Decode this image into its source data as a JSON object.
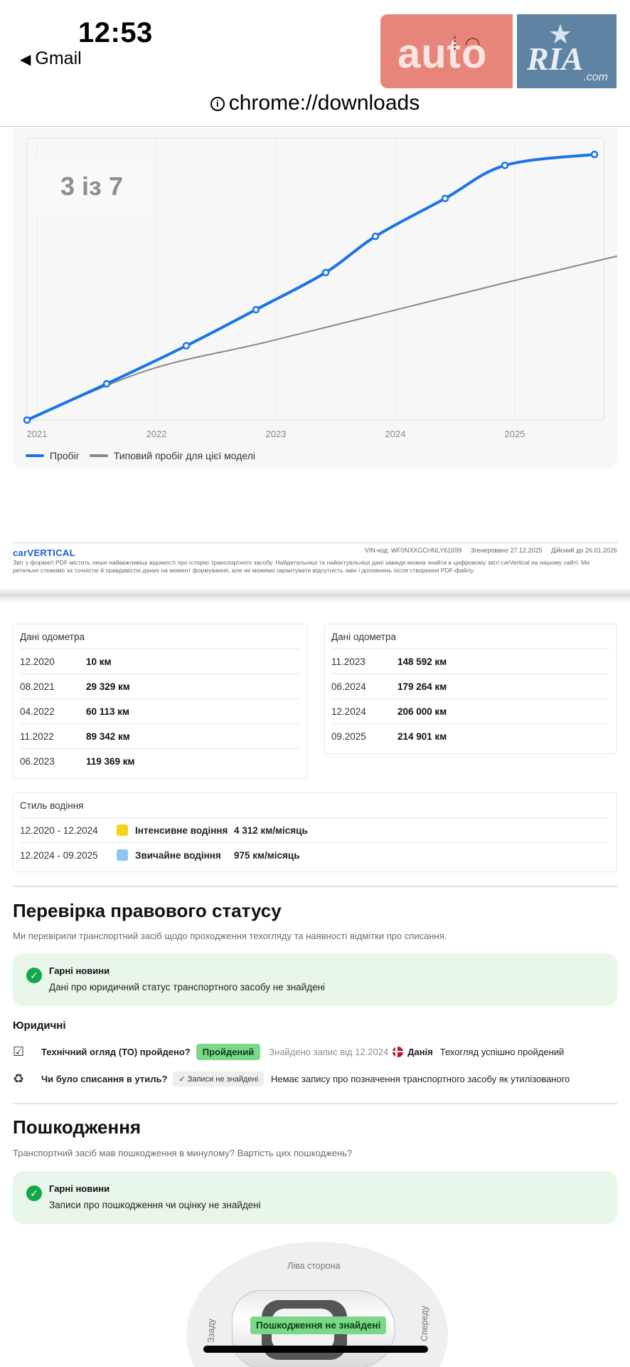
{
  "status": {
    "time": "12:53",
    "back_app": "Gmail",
    "url": "chrome://downloads"
  },
  "watermark": {
    "part1": "auto",
    "part2": "RIA",
    "part3": ".com"
  },
  "viewer": {
    "page_indicator": "3 із 7"
  },
  "chart_data": {
    "type": "line",
    "x_ticks": [
      "2021",
      "2022",
      "2023",
      "2024",
      "2025"
    ],
    "series": [
      {
        "name": "Пробіг",
        "color": "#1a73e8",
        "points": [
          {
            "x": "12.2020",
            "y": 10
          },
          {
            "x": "08.2021",
            "y": 29329
          },
          {
            "x": "04.2022",
            "y": 60113
          },
          {
            "x": "11.2022",
            "y": 89342
          },
          {
            "x": "06.2023",
            "y": 119369
          },
          {
            "x": "11.2023",
            "y": 148592
          },
          {
            "x": "06.2024",
            "y": 179264
          },
          {
            "x": "12.2024",
            "y": 206000
          },
          {
            "x": "09.2025",
            "y": 214901
          }
        ]
      },
      {
        "name": "Типовий пробіг для цієї моделі",
        "color": "#8a8a8a",
        "points": [
          {
            "x": "12.2020",
            "y": 0
          },
          {
            "x": "12.2021",
            "y": 40000
          },
          {
            "x": "12.2022",
            "y": 63000
          },
          {
            "x": "12.2023",
            "y": 87000
          },
          {
            "x": "12.2024",
            "y": 111000
          },
          {
            "x": "12.2025",
            "y": 134000
          }
        ]
      }
    ]
  },
  "footer": {
    "brand": "carVERTICAL",
    "vin": "VIN-код:  WF0NXXGCHNLY61699",
    "generated": "Згенеровано  27.12.2025",
    "valid": "Дійсний до  26.01.2026",
    "disclaimer": "Звіт у форматі PDF містить лише найважливіші відомості про історію транспортного засобу. Найдетальніші та найактуальніші дані завжди можна знайти в цифровому звіті carVertical на нашому сайті. Ми ретельно стежимо за точністю й правдивістю даних на момент формування, але не можемо гарантувати відсутність змін і доповнень після створення PDF-файлу."
  },
  "odometer": {
    "title": "Дані одометра",
    "left": [
      {
        "date": "12.2020",
        "km": "10 км"
      },
      {
        "date": "08.2021",
        "km": "29 329 км"
      },
      {
        "date": "04.2022",
        "km": "60 113 км"
      },
      {
        "date": "11.2022",
        "km": "89 342 км"
      },
      {
        "date": "06.2023",
        "km": "119 369 км"
      }
    ],
    "right": [
      {
        "date": "11.2023",
        "km": "148 592 км"
      },
      {
        "date": "06.2024",
        "km": "179 264 км"
      },
      {
        "date": "12.2024",
        "km": "206 000 км"
      },
      {
        "date": "09.2025",
        "km": "214 901 км"
      }
    ]
  },
  "driving": {
    "title": "Стиль водіння",
    "rows": [
      {
        "period": "12.2020 - 12.2024",
        "style": "Інтенсивне водіння",
        "color": "#f7d21c",
        "rate": "4 312 км/місяць"
      },
      {
        "period": "12.2024 - 09.2025",
        "style": "Звичайне водіння",
        "color": "#8ec5f7",
        "rate": "975 км/місяць"
      }
    ]
  },
  "legal": {
    "title": "Перевірка правового статусу",
    "subtitle": "Ми перевірили транспортний засіб щодо проходження техогляду та наявності відмітки про списання.",
    "good_title": "Гарні новини",
    "good_text": "Дані про юридичний статус транспортного засобу не знайдені",
    "group_title": "Юридичні",
    "inspection_q": "Технічний огляд (ТО) пройдено?",
    "inspection_badge": "Пройдений",
    "inspection_found": "Знайдено запис від 12.2024",
    "inspection_country": "Данія",
    "inspection_result": "Техогляд успішно пройдений",
    "scrap_q": "Чи було списання в утиль?",
    "scrap_badge": "Записи не знайдені",
    "scrap_text": "Немає запису про позначення транспортного засобу як утилізованого"
  },
  "damage": {
    "title": "Пошкодження",
    "subtitle": "Транспортний засіб мав пошкодження в минулому? Вартість цих пошкоджень?",
    "good_title": "Гарні новини",
    "good_text": "Записи про пошкодження чи оцінку не знайдені",
    "side_left": "Ліва сторона",
    "side_rear": "Ззаду",
    "side_front": "Спереду",
    "badge": "Пошкодження не знайдені"
  }
}
